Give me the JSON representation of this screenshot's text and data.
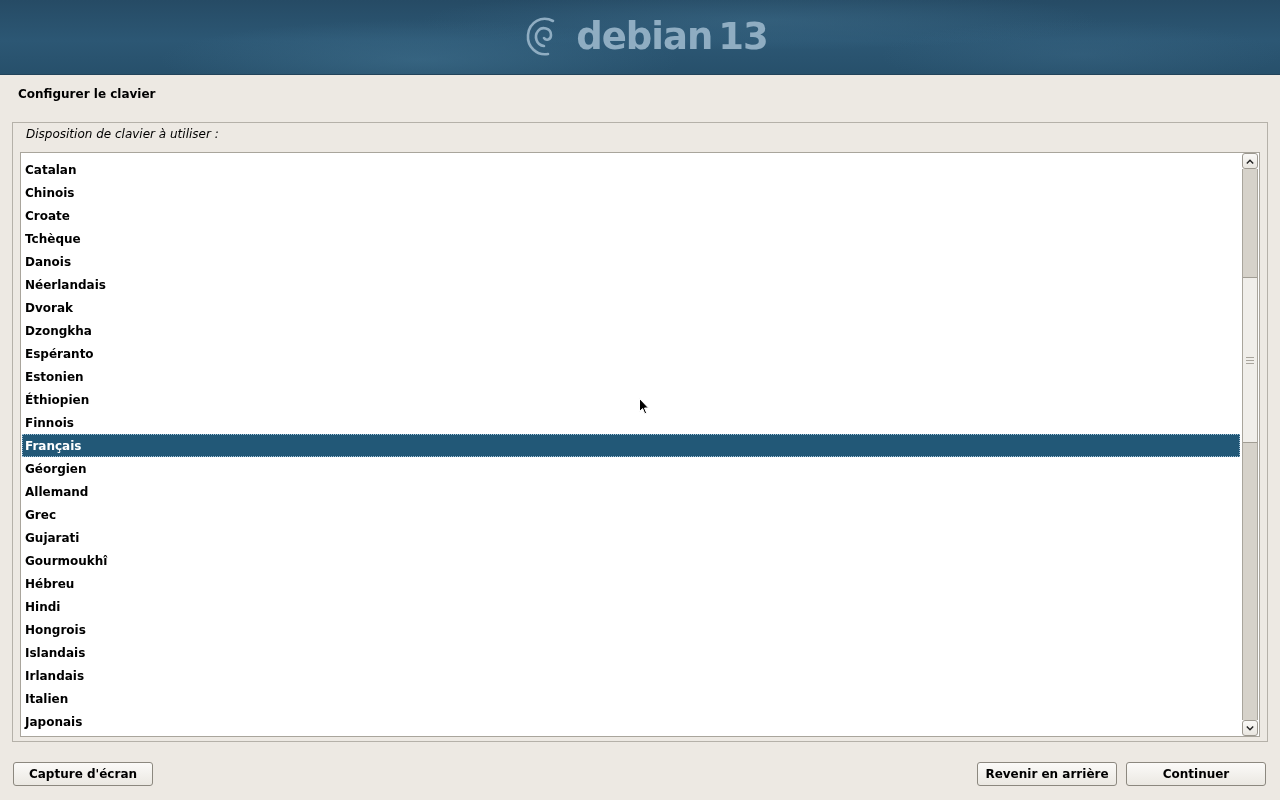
{
  "header": {
    "logo": {
      "name": "debian",
      "version": "13"
    }
  },
  "page": {
    "title": "Configurer le clavier"
  },
  "question": {
    "label": "Disposition de clavier à utiliser :",
    "options": [
      {
        "label": "Catalan",
        "selected": false
      },
      {
        "label": "Chinois",
        "selected": false
      },
      {
        "label": "Croate",
        "selected": false
      },
      {
        "label": "Tchèque",
        "selected": false
      },
      {
        "label": "Danois",
        "selected": false
      },
      {
        "label": "Néerlandais",
        "selected": false
      },
      {
        "label": "Dvorak",
        "selected": false
      },
      {
        "label": "Dzongkha",
        "selected": false
      },
      {
        "label": "Espéranto",
        "selected": false
      },
      {
        "label": "Estonien",
        "selected": false
      },
      {
        "label": "Éthiopien",
        "selected": false
      },
      {
        "label": "Finnois",
        "selected": false
      },
      {
        "label": "Français",
        "selected": true
      },
      {
        "label": "Géorgien",
        "selected": false
      },
      {
        "label": "Allemand",
        "selected": false
      },
      {
        "label": "Grec",
        "selected": false
      },
      {
        "label": "Gujarati",
        "selected": false
      },
      {
        "label": "Gourmoukhî",
        "selected": false
      },
      {
        "label": "Hébreu",
        "selected": false
      },
      {
        "label": "Hindi",
        "selected": false
      },
      {
        "label": "Hongrois",
        "selected": false
      },
      {
        "label": "Islandais",
        "selected": false
      },
      {
        "label": "Irlandais",
        "selected": false
      },
      {
        "label": "Italien",
        "selected": false
      },
      {
        "label": "Japonais",
        "selected": false
      }
    ]
  },
  "buttons": [
    {
      "label": "Capture d'écran",
      "kind": "screenshot"
    },
    {
      "label": "Revenir en arrière",
      "kind": "back"
    },
    {
      "label": "Continuer",
      "kind": "continue"
    }
  ]
}
